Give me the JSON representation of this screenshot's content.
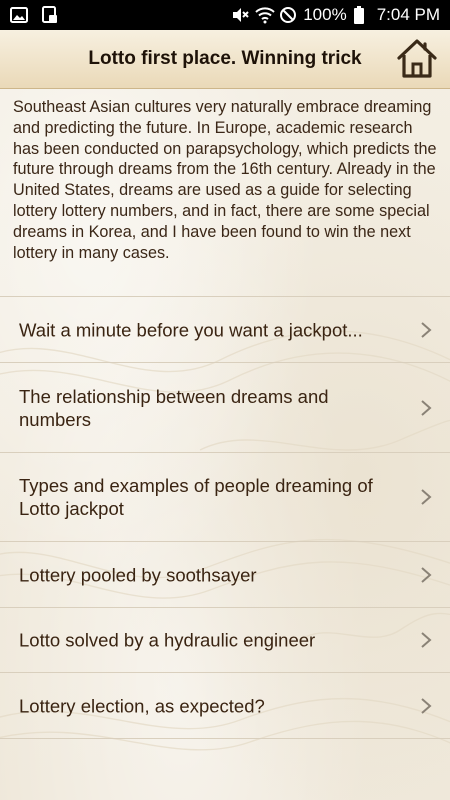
{
  "status_bar": {
    "battery": "100%",
    "time": "7:04 PM",
    "left_icons": [
      "image-icon",
      "cast-icon"
    ],
    "right_icons": [
      "mute-icon",
      "wifi-icon",
      "no-disturb-icon",
      "battery-icon"
    ]
  },
  "header": {
    "title": "Lotto first place. Winning trick",
    "home_icon": "home-icon"
  },
  "intro": {
    "text": "Southeast Asian cultures very naturally embrace dreaming and predicting the future. In Europe, academic research has been conducted on parapsychology, which predicts the future through dreams from the 16th century. Already in the United States, dreams are used as a guide for selecting lottery lottery numbers, and in fact, there are some special dreams in Korea, and I have been found to win the next lottery in many cases."
  },
  "menu": {
    "items": [
      {
        "label": "Wait a minute before you want a jackpot..."
      },
      {
        "label": "The relationship between dreams and numbers"
      },
      {
        "label": "Types and examples of people dreaming of Lotto jackpot"
      },
      {
        "label": "Lottery pooled by soothsayer"
      },
      {
        "label": "Lotto solved by a hydraulic engineer"
      },
      {
        "label": "Lottery election, as expected?"
      }
    ],
    "chevron_icon": "chevron-right-icon"
  },
  "colors": {
    "header_gradient_top": "#f7f0e0",
    "header_gradient_bottom": "#ead9b8",
    "text": "#3a2412",
    "background": "#f3eee3",
    "divider": "#d9cfbd"
  }
}
